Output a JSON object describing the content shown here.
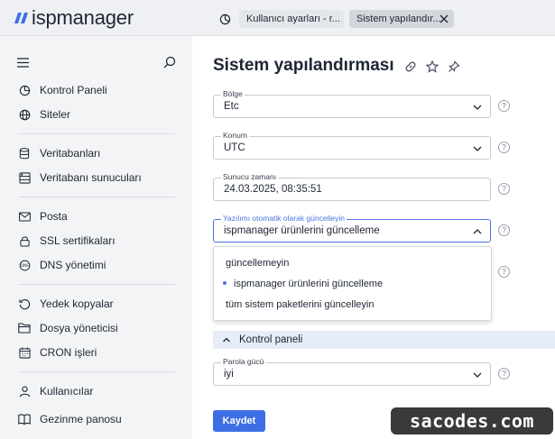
{
  "app": {
    "brand": "ispmanager",
    "brand_color": "#3d6ee3"
  },
  "tabs": [
    {
      "label": "Kullanıcı ayarları - r...",
      "active": false
    },
    {
      "label": "Sistem yapılandır...",
      "active": true
    }
  ],
  "sidebar": {
    "items": [
      {
        "label": "Kontrol Paneli",
        "icon": "dashboard-icon"
      },
      {
        "label": "Siteler",
        "icon": "globe-icon"
      },
      {
        "label": "Veritabanları",
        "icon": "database-icon"
      },
      {
        "label": "Veritabanı sunucuları",
        "icon": "database-server-icon"
      },
      {
        "label": "Posta",
        "icon": "mail-icon"
      },
      {
        "label": "SSL sertifikaları",
        "icon": "lock-icon"
      },
      {
        "label": "DNS yönetimi",
        "icon": "dns-icon"
      },
      {
        "label": "Yedek kopyalar",
        "icon": "backup-icon"
      },
      {
        "label": "Dosya yöneticisi",
        "icon": "folder-icon"
      },
      {
        "label": "CRON işleri",
        "icon": "calendar-icon"
      },
      {
        "label": "Kullanıcılar",
        "icon": "user-icon"
      },
      {
        "label": "Gezinme panosu",
        "icon": "book-icon"
      }
    ]
  },
  "page": {
    "title": "Sistem yapılandırması",
    "fields": {
      "region": {
        "label": "Bölge",
        "value": "Etc"
      },
      "location": {
        "label": "Konum",
        "value": "UTC"
      },
      "server_time": {
        "label": "Sunucu zamanı",
        "value": "24.03.2025, 08:35:51"
      },
      "auto_update": {
        "label": "Yazılımı otomatik olarak güncelleyin",
        "value": "ispmanager ürünlerini güncelleme"
      },
      "password_strength": {
        "label": "Parola gücü",
        "value": "iyi"
      }
    },
    "auto_update_options": [
      "güncellemeyin",
      "ispmanager ürünlerini güncelleme",
      "tüm sistem paketlerini güncelleyin"
    ],
    "auto_update_selected_index": 1,
    "section": "Kontrol paneli",
    "help_glyph": "?",
    "save_label": "Kaydet"
  },
  "watermark": "sacodes.com"
}
